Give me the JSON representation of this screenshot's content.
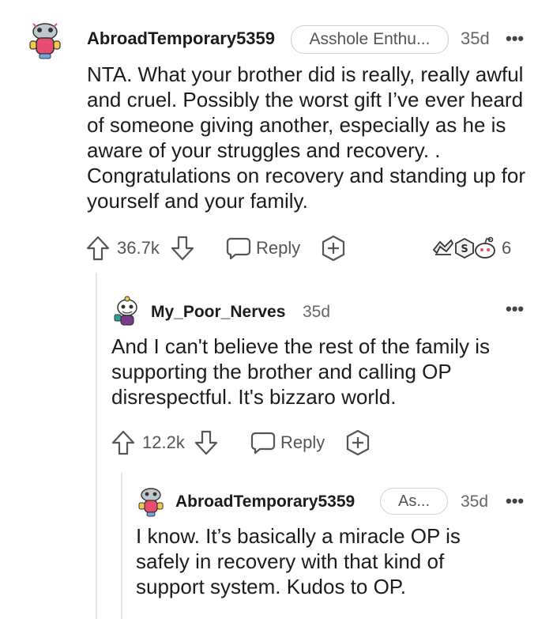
{
  "comments": [
    {
      "username": "AbroadTemporary5359",
      "flair": "Asshole Enthu...",
      "time": "35d",
      "more": "•••",
      "body": "NTA. What your brother did is really, really awful and cruel. Possibly the worst gift I’ve ever heard of someone giving another, especially as he is aware of your struggles and recovery. . Congratulations on recovery and standing up for yourself and your family.",
      "upvotes": "36.7k",
      "reply_label": "Reply",
      "award_count": "6"
    },
    {
      "username": "My_Poor_Nerves",
      "time": "35d",
      "more": "•••",
      "body": "And I can't believe the rest of the family is supporting the brother and calling OP disrespectful. It's bizzaro world.",
      "upvotes": "12.2k",
      "reply_label": "Reply"
    },
    {
      "username": "AbroadTemporary5359",
      "flair": "As...",
      "time": "35d",
      "more": "•••",
      "body": "I know. It’s basically a miracle OP is safely in recovery with that kind of support system. Kudos to OP."
    }
  ],
  "icons": {
    "upvote": "arrow-up-icon",
    "downvote": "arrow-down-icon",
    "reply": "speech-bubble-icon",
    "award": "plus-hexagon-icon",
    "more": "ellipsis-icon"
  },
  "colors": {
    "text": "#1c1c1c",
    "meta": "#666666",
    "icon": "#555555",
    "thread_line": "#e6e6e6",
    "flair_border": "#cfcfcf"
  }
}
